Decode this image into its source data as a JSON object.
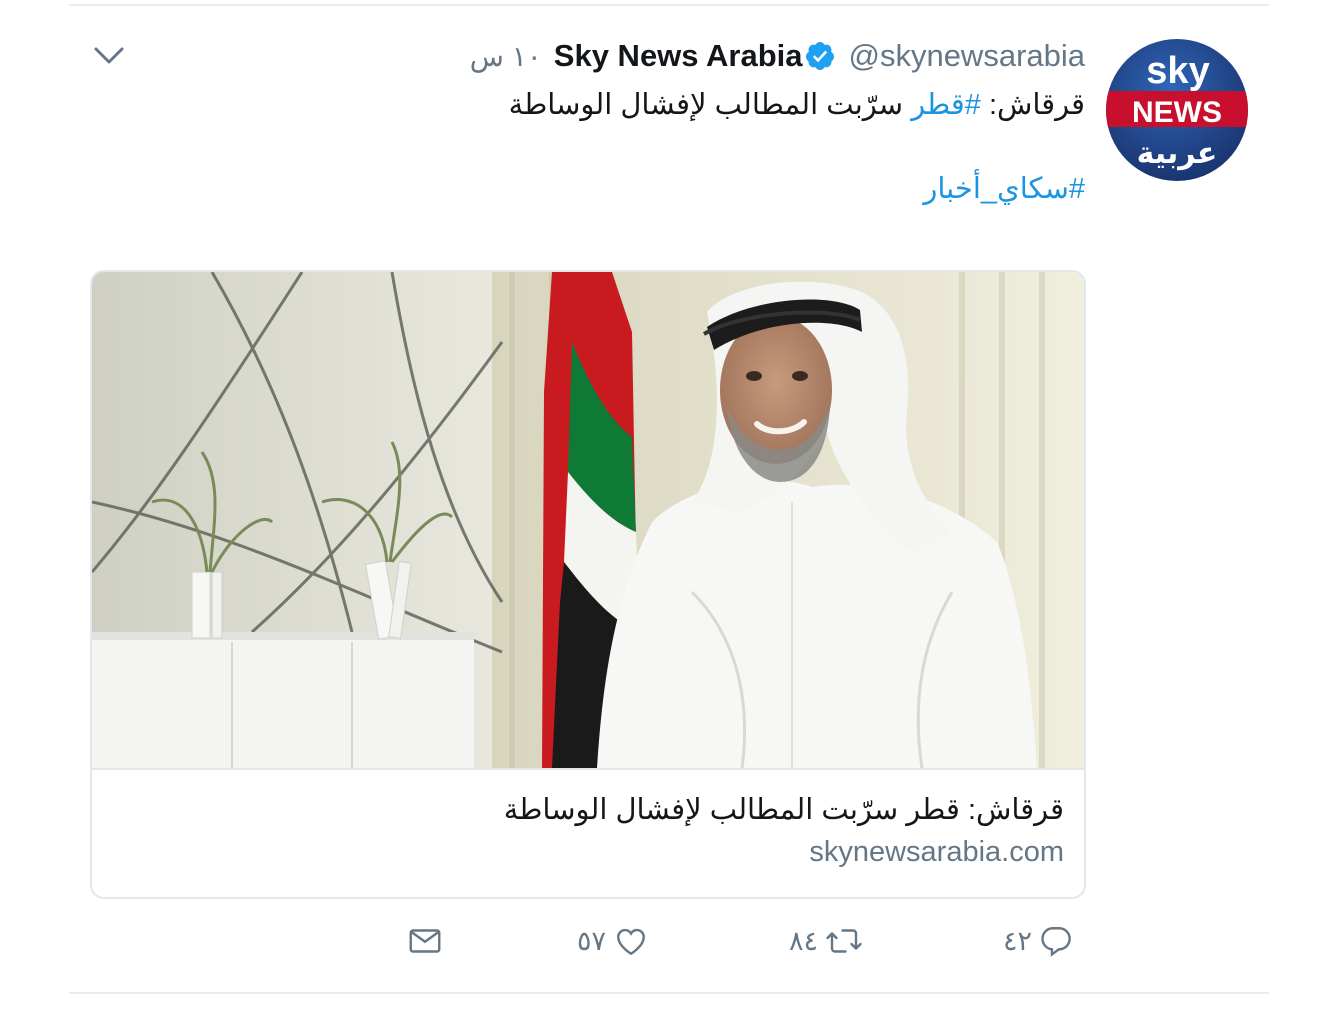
{
  "tweet": {
    "display_name": "Sky News Arabia",
    "handle": "@skynewsarabia",
    "timestamp": "١٠ س",
    "text_before": "قرقاش: ",
    "hashtag_1": "#قطر",
    "text_after": " سرّبت المطالب لإفشال الوساطة",
    "hashtag_2": "#سكاي_أخبار"
  },
  "card": {
    "title": "قرقاش: قطر سرّبت المطالب لإفشال الوساطة",
    "domain": "skynewsarabia.com"
  },
  "actions": {
    "reply_count": "٤٢",
    "retweet_count": "٨٤",
    "like_count": "٥٧"
  },
  "avatar": {
    "line_1": "sky",
    "line_2": "NEWS",
    "line_3": "عربية"
  },
  "colors": {
    "link": "#1b95e0",
    "muted": "#657786",
    "verified": "#1da1f2",
    "avatar_red": "#c8102e"
  },
  "icons": {
    "menu": "chevron-down-icon",
    "verified": "verified-badge-icon",
    "reply": "reply-icon",
    "retweet": "retweet-icon",
    "like": "heart-icon",
    "message": "envelope-icon"
  }
}
